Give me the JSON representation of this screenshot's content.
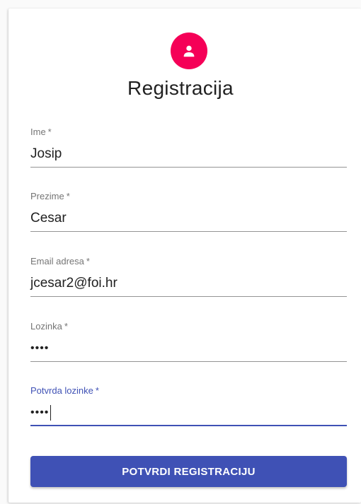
{
  "form": {
    "title": "Registracija",
    "fields": [
      {
        "label": "Ime",
        "value": "Josip",
        "required_mark": "*"
      },
      {
        "label": "Prezime",
        "value": "Cesar",
        "required_mark": "*"
      },
      {
        "label": "Email adresa",
        "value": "jcesar2@foi.hr",
        "required_mark": "*"
      },
      {
        "label": "Lozinka",
        "value": "••••",
        "required_mark": "*"
      },
      {
        "label": "Potvrda lozinke",
        "value": "••••",
        "required_mark": "*",
        "focused": true
      }
    ],
    "submit_label": "POTVRDI REGISTRACIJU"
  },
  "icons": {
    "avatar_icon": "person-icon"
  },
  "colors": {
    "avatar_bg": "#f50057",
    "primary": "#3f51b5",
    "label": "#757575",
    "text": "#212121",
    "underline": "#949494"
  }
}
